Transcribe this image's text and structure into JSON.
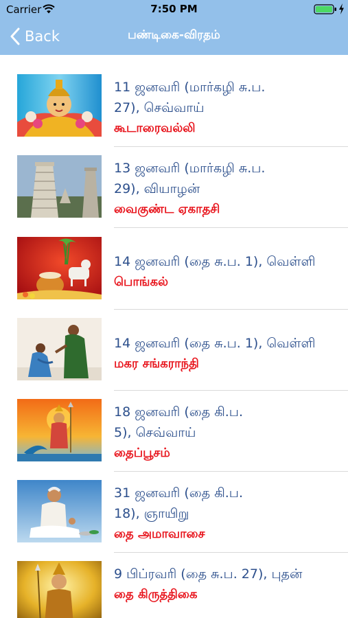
{
  "status_bar": {
    "carrier": "Carrier",
    "time": "7:50 PM",
    "wifi_icon": "wifi-icon",
    "battery_icon": "battery-charging-icon"
  },
  "nav": {
    "back_label": "Back",
    "title": "பண்டிகை-விரதம்",
    "background_color": "#93c0ea"
  },
  "colors": {
    "date_text": "#2c4f8c",
    "festival_text": "#e8161e"
  },
  "items": [
    {
      "date_line1": "11 ஜனவரி (மார்கழி சு.ப.",
      "date_line2": "27), செவ்வாய்",
      "festival": "கூடாரைவல்லி",
      "image": "goddess-image"
    },
    {
      "date_line1": "13 ஜனவரி (மார்கழி சு.ப.",
      "date_line2": "29), வியாழன்",
      "festival": "வைகுண்ட ஏகாதசி",
      "image": "temple-tower-image"
    },
    {
      "date_line1": "14 ஜனவரி (தை சு.ப. 1), வெள்ளி",
      "date_line2": "",
      "festival": "பொங்கல்",
      "image": "pongal-pot-cow-image"
    },
    {
      "date_line1": "14 ஜனவரி (தை சு.ப. 1), வெள்ளி",
      "date_line2": "",
      "festival": "மகர சங்கராந்தி",
      "image": "women-blessing-image"
    },
    {
      "date_line1": "18 ஜனவரி (தை கி.ப.",
      "date_line2": "5), செவ்வாய்",
      "festival": "தைப்பூசம்",
      "image": "murugan-peacock-image"
    },
    {
      "date_line1": "31 ஜனவரி (தை கி.ப.",
      "date_line2": "18), ஞாயிறு",
      "festival": "தை அமாவாசை",
      "image": "ritual-man-image"
    },
    {
      "date_line1": "9 பிப்ரவரி (தை சு.ப. 27), புதன்",
      "date_line2": "",
      "festival": "தை கிருத்திகை",
      "image": "murugan-golden-image"
    }
  ]
}
